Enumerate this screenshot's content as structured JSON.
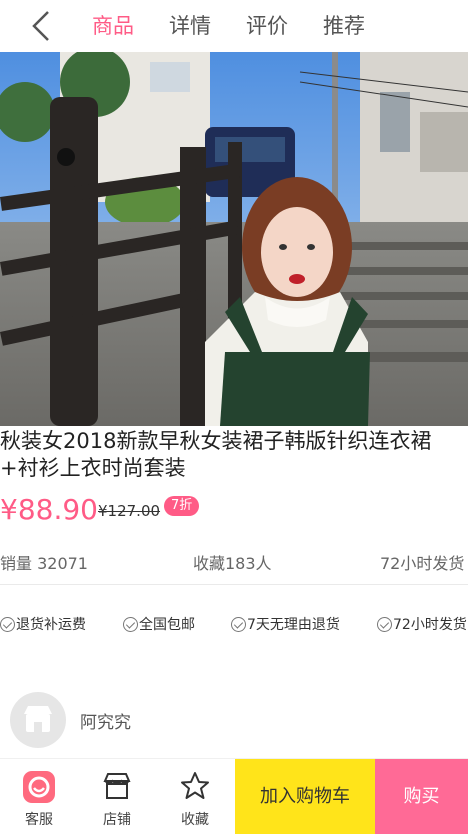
{
  "nav": {
    "tabs": [
      {
        "label": "商品",
        "active": true
      },
      {
        "label": "详情",
        "active": false
      },
      {
        "label": "评价",
        "active": false
      },
      {
        "label": "推荐",
        "active": false
      }
    ],
    "back_icon": "chevron-left-icon",
    "accent_color": "#ff5b86"
  },
  "product": {
    "title": "秋装女2018新款早秋女装裙子韩版针织连衣裙+衬衫上衣时尚套装",
    "price": "¥88.90",
    "old_price": "¥127.00",
    "discount": "7折"
  },
  "stats": {
    "sales": "销量 32071",
    "favorites": "收藏183人",
    "shipping": "72小时发货"
  },
  "services": [
    "退货补运费",
    "全国包邮",
    "7天无理由退货",
    "72小时发货"
  ],
  "shop": {
    "name": "阿究究",
    "avatar_icon": "store-icon"
  },
  "bottom_bar": {
    "service_label": "客服",
    "store_label": "店铺",
    "favorite_label": "收藏",
    "cart_label": "加入购物车",
    "buy_label": "购买",
    "cart_color": "#ffe41a",
    "buy_color": "#ff6a96"
  }
}
